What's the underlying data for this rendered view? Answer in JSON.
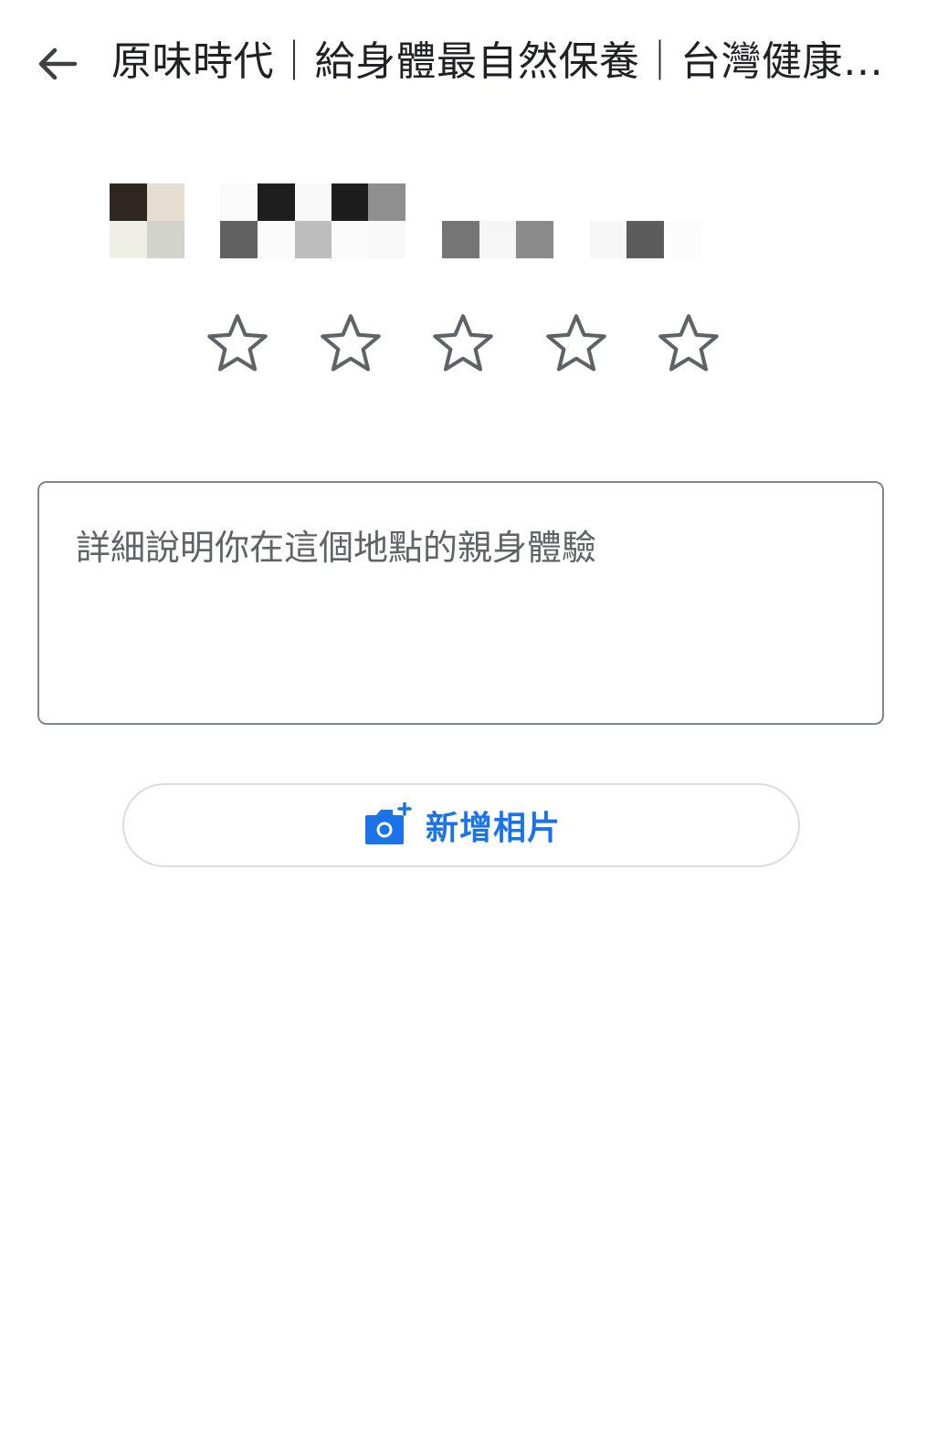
{
  "header": {
    "back_icon": "arrow-left-icon",
    "title": "原味時代｜給身體最自然保養｜台灣健康…"
  },
  "user": {
    "avatar_blurred": true,
    "name_blurred": true
  },
  "rating": {
    "max_stars": 5,
    "selected": 0,
    "star_icon": "star-outline-icon",
    "star_color": "#5f6368"
  },
  "review": {
    "placeholder": "詳細說明你在這個地點的親身體驗",
    "value": ""
  },
  "add_photo": {
    "icon": "add-photo-camera-icon",
    "label": "新增相片",
    "accent_color": "#1a73e8"
  }
}
